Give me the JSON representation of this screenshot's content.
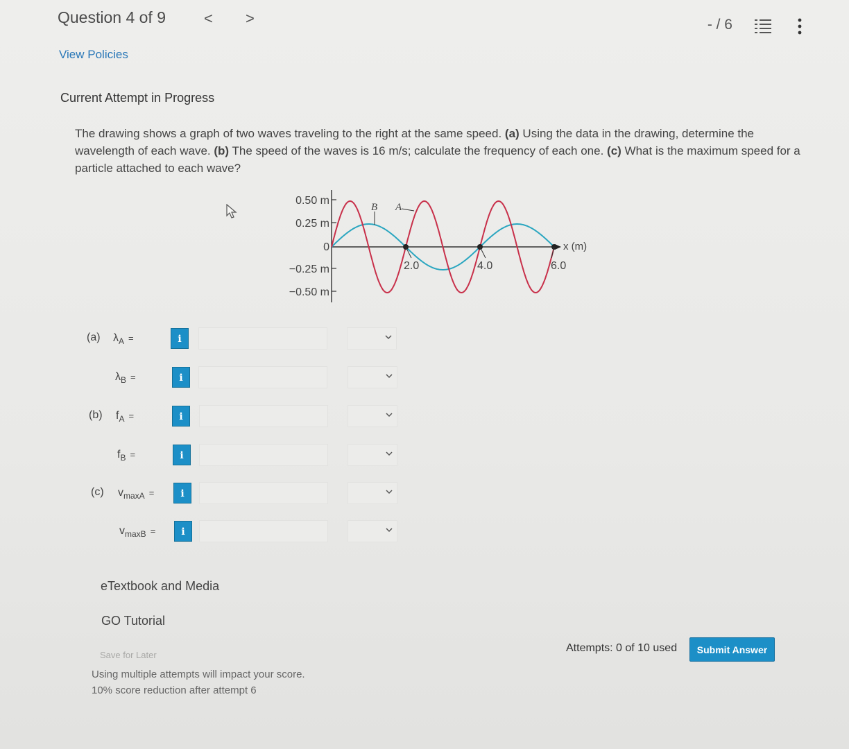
{
  "header": {
    "question_label": "Question 4 of 9",
    "prev_glyph": "<",
    "next_glyph": ">",
    "score": "- / 6",
    "list_icon": "list-icon",
    "more_icon": "more-vertical-icon"
  },
  "view_policies": "View Policies",
  "attempt_heading": "Current Attempt in Progress",
  "problem": {
    "t1": "The drawing shows a graph of two waves traveling to the right at the same speed. ",
    "a": "(a)",
    "t2": " Using the data in the drawing, determine the wavelength of each wave. ",
    "b": "(b)",
    "t3": " The speed of the waves is 16 m/s; calculate the frequency of each one. ",
    "c": "(c)",
    "t4": " What is the maximum speed for a particle attached to each wave?"
  },
  "graph": {
    "y_ticks": [
      "0.50 m",
      "0.25 m",
      "0",
      "−0.25 m",
      "−0.50 m"
    ],
    "x_ticks": [
      "2.0",
      "4.0",
      "6.0"
    ],
    "x_axis_label": "x (m)",
    "label_B": "B",
    "label_A": "A",
    "colors": {
      "wave_A": "#c8304a",
      "wave_B": "#2aa6c0",
      "axis": "#333333"
    }
  },
  "rows": [
    {
      "part": "(a)",
      "sym": "λ",
      "sub": "A",
      "eq": "=",
      "input": "",
      "unit": ""
    },
    {
      "part": "",
      "sym": "λ",
      "sub": "B",
      "eq": "=",
      "input": "",
      "unit": ""
    },
    {
      "part": "(b)",
      "sym": "f",
      "sub": "A",
      "eq": "=",
      "input": "",
      "unit": ""
    },
    {
      "part": "",
      "sym": "f",
      "sub": "B",
      "eq": "=",
      "input": "",
      "unit": ""
    },
    {
      "part": "(c)",
      "sym": "v",
      "sub": "maxA",
      "eq": "=",
      "input": "",
      "unit": ""
    },
    {
      "part": "",
      "sym": "v",
      "sub": "maxB",
      "eq": "=",
      "input": "",
      "unit": ""
    }
  ],
  "info_glyph": "i",
  "etextbook": "eTextbook and Media",
  "go_tutorial": "GO Tutorial",
  "save_later": "Save for Later",
  "note_line1": "Using multiple attempts will impact your score.",
  "note_line2": "10% score reduction after attempt 6",
  "attempts": "Attempts: 0 of 10 used",
  "submit": "Submit Answer"
}
